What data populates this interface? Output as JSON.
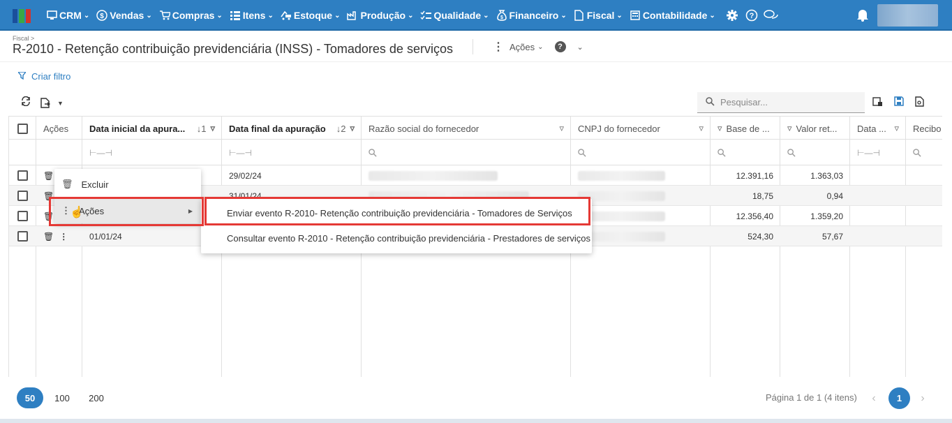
{
  "nav": {
    "items": [
      {
        "label": "CRM",
        "icon": "crm-icon"
      },
      {
        "label": "Vendas",
        "icon": "dollar-icon"
      },
      {
        "label": "Compras",
        "icon": "cart-icon"
      },
      {
        "label": "Itens",
        "icon": "items-icon"
      },
      {
        "label": "Estoque",
        "icon": "truck-icon"
      },
      {
        "label": "Produção",
        "icon": "factory-icon"
      },
      {
        "label": "Qualidade",
        "icon": "checklist-icon"
      },
      {
        "label": "Financeiro",
        "icon": "money-bag-icon"
      },
      {
        "label": "Fiscal",
        "icon": "document-icon"
      },
      {
        "label": "Contabilidade",
        "icon": "calculator-icon"
      }
    ],
    "settings_icon": "gear-icon",
    "help_icon": "question-icon",
    "chat_icon": "chat-icon",
    "bell_icon": "bell-icon"
  },
  "header": {
    "breadcrumb": "Fiscal >",
    "title": "R-2010 - Retenção contribuição previdenciária (INSS) - Tomadores de serviços",
    "actions_label": "Ações",
    "help": "?"
  },
  "filters": {
    "create_label": "Criar filtro"
  },
  "search": {
    "placeholder": "Pesquisar..."
  },
  "table": {
    "columns": [
      "Ações",
      "Data inicial da apura...",
      "Data final da apuração",
      "Razão social do fornecedor",
      "CNPJ do fornecedor",
      "Base de ...",
      "Valor ret...",
      "Data ...",
      "Recibo"
    ],
    "sort_indicators": [
      "↓1",
      "↓2"
    ],
    "rows": [
      {
        "start": "",
        "end": "29/02/24",
        "base": "12.391,16",
        "valor": "1.363,03"
      },
      {
        "start": "",
        "end": "31/01/24",
        "base": "18,75",
        "valor": "0,94"
      },
      {
        "start": "",
        "end": "",
        "base": "12.356,40",
        "valor": "1.359,20"
      },
      {
        "start": "01/01/24",
        "end": "",
        "base": "524,30",
        "valor": "57,67"
      }
    ]
  },
  "context_menu": {
    "items": [
      {
        "label": "Excluir",
        "icon": "trash-icon"
      },
      {
        "label": "Ações",
        "icon": "dots-vertical-icon"
      }
    ],
    "submenu": [
      "Enviar evento R-2010- Retenção contribuição previdenciária - Tomadores de Serviços",
      "Consultar evento R-2010 - Retenção contribuição previdenciária - Prestadores de serviços"
    ]
  },
  "pagination": {
    "sizes": [
      "50",
      "100",
      "200"
    ],
    "info": "Página 1 de 1 (4 itens)",
    "current": "1"
  },
  "colors": {
    "primary": "#2e7fc2",
    "highlight": "#e53935"
  }
}
